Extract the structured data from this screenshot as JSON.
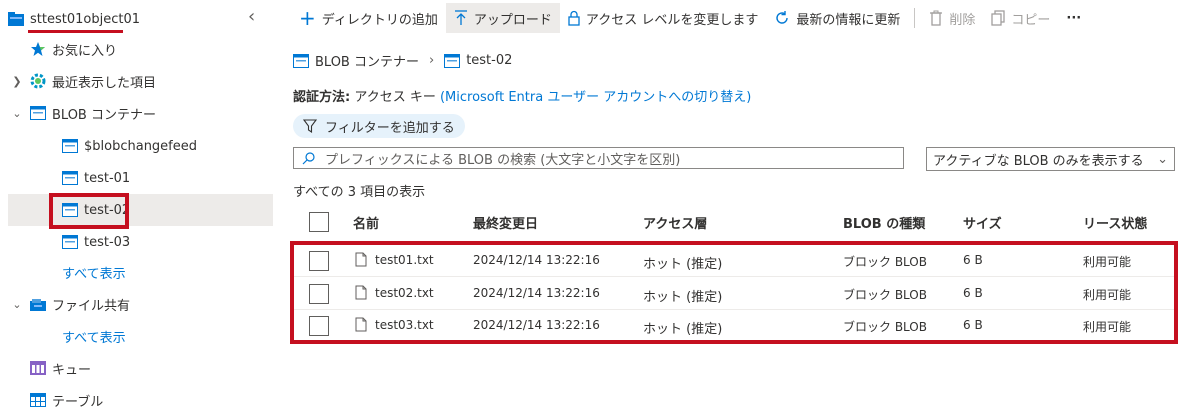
{
  "sidebar": {
    "account": "sttest01object01",
    "collapse_glyph": "‹",
    "items": [
      {
        "label": "お気に入り"
      },
      {
        "label": "最近表示した項目"
      },
      {
        "label": "BLOB コンテナー"
      },
      {
        "label": "$blobchangefeed"
      },
      {
        "label": "test-01"
      },
      {
        "label": "test-02"
      },
      {
        "label": "test-03"
      },
      {
        "label": "すべて表示"
      },
      {
        "label": "ファイル共有"
      },
      {
        "label": "すべて表示"
      },
      {
        "label": "キュー"
      },
      {
        "label": "テーブル"
      }
    ]
  },
  "toolbar": {
    "add_directory": "ディレクトリの追加",
    "upload": "アップロード",
    "change_access": "アクセス レベルを変更します",
    "refresh": "最新の情報に更新",
    "delete": "削除",
    "copy": "コピー",
    "more": "···"
  },
  "breadcrumb": {
    "root": "BLOB コンテナー",
    "current": "test-02"
  },
  "auth": {
    "label": "認証方法:",
    "value": "アクセス キー",
    "switch_link": "(Microsoft Entra ユーザー アカウントへの切り替え)"
  },
  "filter": {
    "label": "フィルターを追加する"
  },
  "search": {
    "placeholder": "プレフィックスによる BLOB の検索 (大文字と小文字を区別)"
  },
  "view_dropdown": {
    "selected": "アクティブな BLOB のみを表示する"
  },
  "summary": "すべての 3 項目の表示",
  "table": {
    "columns": [
      "名前",
      "最終変更日",
      "アクセス層",
      "BLOB の種類",
      "サイズ",
      "リース状態"
    ],
    "rows": [
      {
        "name": "test01.txt",
        "modified": "2024/12/14 13:22:16",
        "tier": "ホット (推定)",
        "type": "ブロック BLOB",
        "size": "6 B",
        "lease": "利用可能"
      },
      {
        "name": "test02.txt",
        "modified": "2024/12/14 13:22:16",
        "tier": "ホット (推定)",
        "type": "ブロック BLOB",
        "size": "6 B",
        "lease": "利用可能"
      },
      {
        "name": "test03.txt",
        "modified": "2024/12/14 13:22:16",
        "tier": "ホット (推定)",
        "type": "ブロック BLOB",
        "size": "6 B",
        "lease": "利用可能"
      }
    ]
  },
  "colors": {
    "accent": "#0078d4",
    "highlight_red": "#c50f1f",
    "selected_bg": "#edebe9"
  }
}
